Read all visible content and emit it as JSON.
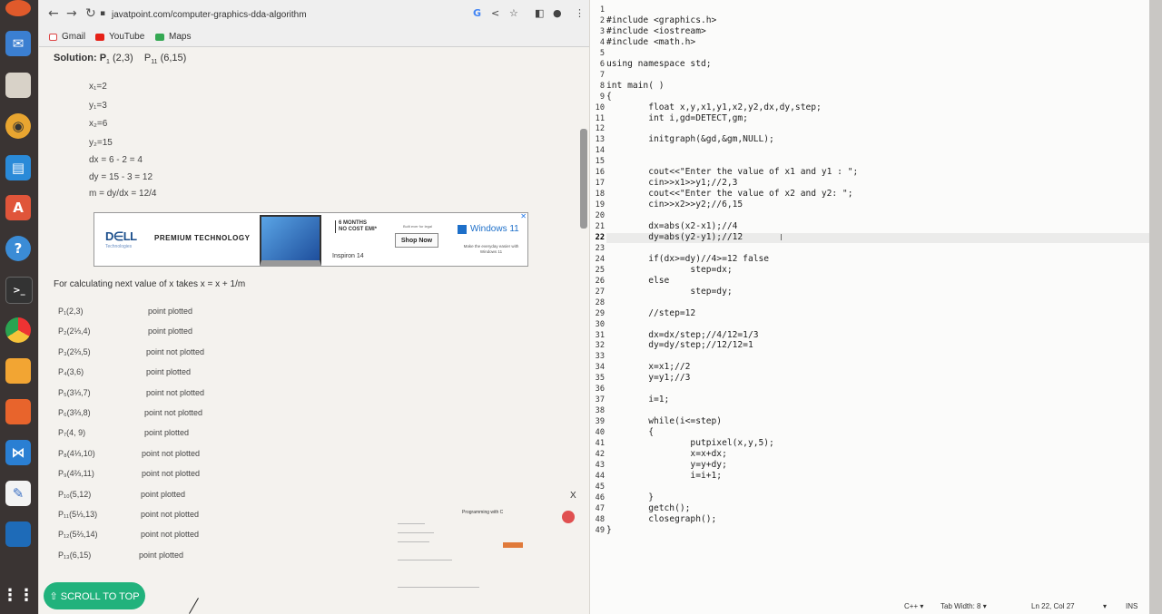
{
  "dock": {
    "icons": [
      "firefox-icon",
      "app-icon",
      "files-icon",
      "rhythmbox-icon",
      "writer-icon",
      "software-icon",
      "help-icon",
      "terminal-icon",
      "chrome-icon",
      "cube-icon",
      "ubuntu-icon",
      "vscode-icon",
      "text-editor-icon",
      "site-icon",
      "grid-icon"
    ]
  },
  "browser": {
    "url": "javatpoint.com/computer-graphics-dda-algorithm",
    "bookmarks": [
      "Gmail",
      "YouTube",
      "Maps"
    ],
    "solution_label": "Solution: P",
    "solution_p1_sub": "1",
    "solution_p1": "(2,3)",
    "solution_p11": "P",
    "solution_p11_sub": "11",
    "solution_p11_val": "(6,15)",
    "calc_lines": [
      "x₁=2",
      "y₁=3",
      "x₂=6",
      "y₂=15",
      "dx = 6 - 2 = 4",
      "dy = 15 - 3 = 12"
    ],
    "m_formula": "m = dy/dx = 12/4",
    "ad": {
      "brand": "D∈LL",
      "brand_sub": "Technologies",
      "tagline": "PREMIUM TECHNOLOGY",
      "months": "6 MONTHS",
      "emi": "NO COST EMI*",
      "model": "Inspiron 14",
      "shop": "Shop Now",
      "tiny1": "Built ever for legal",
      "windows": "Windows 11",
      "tiny2": "Make the everyday easier with Windows 11"
    },
    "calc_next": "For calculating next value of x takes x = x + 1/m",
    "points": [
      {
        "label": "P₁(2,3)",
        "status": "point plotted"
      },
      {
        "label": "P₂(2⅓,4)",
        "status": "point plotted"
      },
      {
        "label": "P₃(2⅔,5)",
        "status": "point not plotted"
      },
      {
        "label": "P₄(3,6)",
        "status": "point plotted"
      },
      {
        "label": "P₅(3⅓,7)",
        "status": "point not plotted"
      },
      {
        "label": "P₆(3⅔,8)",
        "status": "point not plotted"
      },
      {
        "label": "P₇(4, 9)",
        "status": "point plotted"
      },
      {
        "label": "P₈(4⅓,10)",
        "status": "point not plotted"
      },
      {
        "label": "P₉(4⅔,11)",
        "status": "point not plotted"
      },
      {
        "label": "P₁₀(5,12)",
        "status": "point plotted"
      },
      {
        "label": "P₁₁(5⅓,13)",
        "status": "point not plotted"
      },
      {
        "label": "P₁₂(5⅔,14)",
        "status": "point not plotted"
      },
      {
        "label": "P₁₃(6,15)",
        "status": "point plotted"
      }
    ],
    "mini_ad_title": "Programming with C",
    "scroll_to_top": "⇧ SCROLL TO TOP"
  },
  "editor": {
    "lines": [
      "",
      "#include <graphics.h>",
      "#include <iostream>",
      "#include <math.h>",
      "",
      "using namespace std;",
      "",
      "int main( )",
      "{",
      "        float x,y,x1,y1,x2,y2,dx,dy,step;",
      "        int i,gd=DETECT,gm;",
      "",
      "        initgraph(&gd,&gm,NULL);",
      "",
      "",
      "        cout<<\"Enter the value of x1 and y1 : \";",
      "        cin>>x1>>y1;//2,3",
      "        cout<<\"Enter the value of x2 and y2: \";",
      "        cin>>x2>>y2;//6,15",
      "",
      "        dx=abs(x2-x1);//4",
      "        dy=abs(y2-y1);//12",
      "",
      "        if(dx>=dy)//4>=12 false",
      "                step=dx;",
      "        else",
      "                step=dy;",
      "",
      "        //step=12",
      "",
      "        dx=dx/step;//4/12=1/3",
      "        dy=dy/step;//12/12=1",
      "",
      "        x=x1;//2",
      "        y=y1;//3",
      "",
      "        i=1;",
      "",
      "        while(i<=step)",
      "        {",
      "                putpixel(x,y,5);",
      "                x=x+dx;",
      "                y=y+dy;",
      "                i=i+1;",
      "",
      "        }",
      "        getch();",
      "        closegraph();",
      "}"
    ],
    "current_line": 22,
    "status": {
      "language": "C++ ▾",
      "tab_width": "Tab Width: 8 ▾",
      "position": "Ln 22, Col 27",
      "dropdown": "▾",
      "mode": "INS"
    }
  }
}
